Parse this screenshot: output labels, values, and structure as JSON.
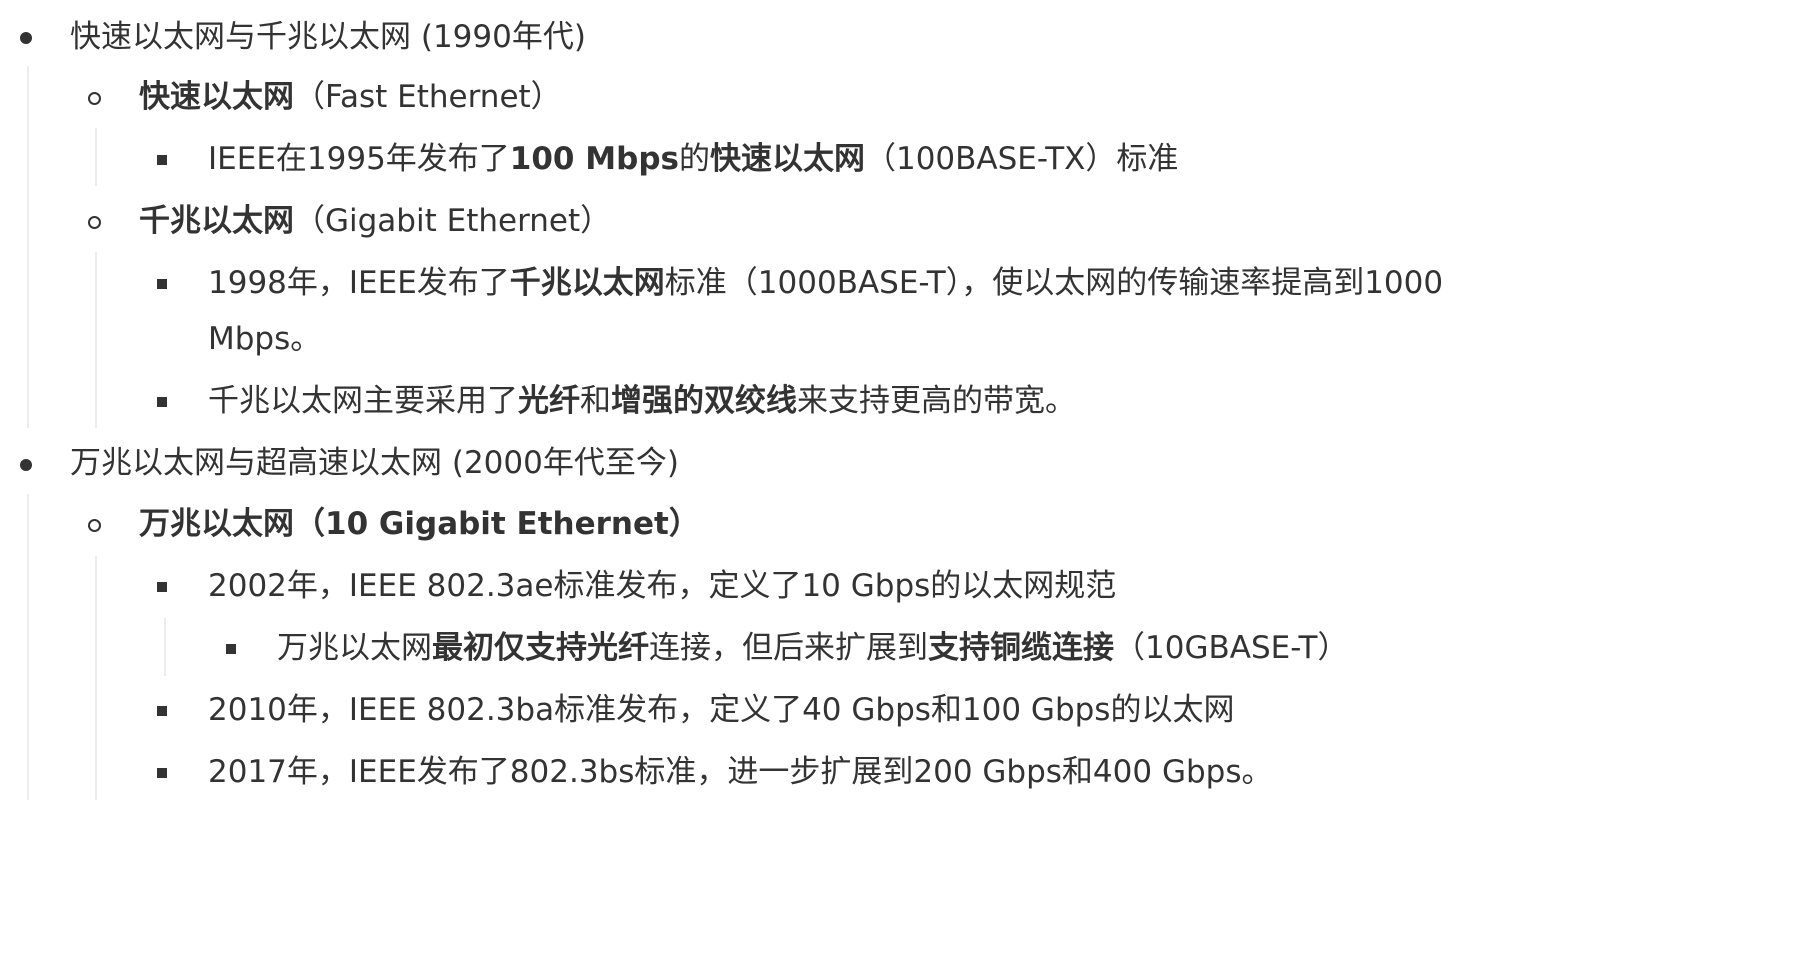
{
  "items": [
    {
      "id": "l1",
      "parts": [
        {
          "t": "快速以太网与千兆以太网 (1990年代)",
          "b": false
        }
      ]
    },
    {
      "id": "l2",
      "parts": [
        {
          "t": "快速以太网",
          "b": true
        },
        {
          "t": "（Fast Ethernet）",
          "b": false
        }
      ]
    },
    {
      "id": "l3",
      "parts": [
        {
          "t": "IEEE在1995年发布了",
          "b": false
        },
        {
          "t": "100 Mbps",
          "b": true
        },
        {
          "t": "的",
          "b": false
        },
        {
          "t": "快速以太网",
          "b": true
        },
        {
          "t": "（100BASE-TX）标准",
          "b": false
        }
      ]
    },
    {
      "id": "l4",
      "parts": [
        {
          "t": "千兆以太网",
          "b": true
        },
        {
          "t": "（Gigabit Ethernet）",
          "b": false
        }
      ]
    },
    {
      "id": "l5a",
      "parts": [
        {
          "t": "1998年，IEEE发布了",
          "b": false
        },
        {
          "t": "千兆以太网",
          "b": true
        },
        {
          "t": "标准（1000BASE-T），使以太网的传输速率提高到1000",
          "b": false
        }
      ]
    },
    {
      "id": "l5b",
      "parts": [
        {
          "t": "Mbps。",
          "b": false
        }
      ]
    },
    {
      "id": "l6",
      "parts": [
        {
          "t": "千兆以太网主要采用了",
          "b": false
        },
        {
          "t": "光纤",
          "b": true
        },
        {
          "t": "和",
          "b": false
        },
        {
          "t": "增强的双绞线",
          "b": true
        },
        {
          "t": "来支持更高的带宽。",
          "b": false
        }
      ]
    },
    {
      "id": "l7",
      "parts": [
        {
          "t": "万兆以太网与超高速以太网 (2000年代至今)",
          "b": false
        }
      ]
    },
    {
      "id": "l8",
      "parts": [
        {
          "t": "万兆以太网（10 Gigabit Ethernet）",
          "b": true
        }
      ]
    },
    {
      "id": "l9",
      "parts": [
        {
          "t": "2002年，IEEE 802.3ae标准发布，定义了10 Gbps的以太网规范",
          "b": false
        }
      ]
    },
    {
      "id": "l10",
      "parts": [
        {
          "t": "万兆以太网",
          "b": false
        },
        {
          "t": "最初仅支持光纤",
          "b": true
        },
        {
          "t": "连接，但后来扩展到",
          "b": false
        },
        {
          "t": "支持铜缆连接",
          "b": true
        },
        {
          "t": "（10GBASE-T）",
          "b": false
        }
      ]
    },
    {
      "id": "l11",
      "parts": [
        {
          "t": "2010年，IEEE 802.3ba标准发布，定义了40 Gbps和100 Gbps的以太网",
          "b": false
        }
      ]
    },
    {
      "id": "l12",
      "parts": [
        {
          "t": "2017年，IEEE发布了802.3bs标准，进一步扩展到200 Gbps和400 Gbps。",
          "b": false
        }
      ]
    }
  ]
}
